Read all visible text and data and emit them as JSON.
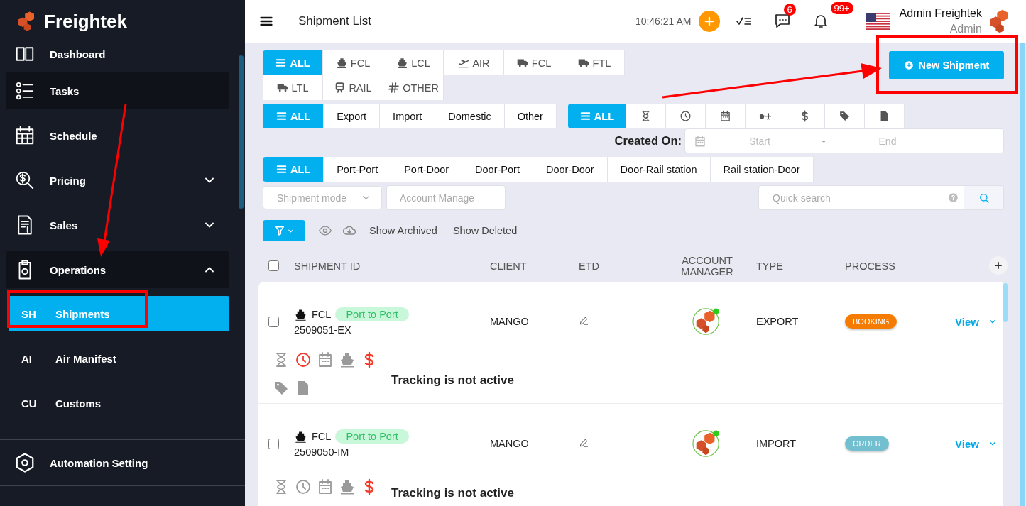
{
  "brand": {
    "name": "Freightek"
  },
  "sidebar": {
    "items": [
      {
        "kind": "link",
        "label": "Dashboard",
        "highlighted": false
      },
      {
        "kind": "link",
        "label": "Tasks",
        "highlighted": true
      },
      {
        "kind": "link",
        "label": "Schedule",
        "highlighted": false
      },
      {
        "kind": "group",
        "label": "Pricing",
        "highlighted": false,
        "expanded": false
      },
      {
        "kind": "group",
        "label": "Sales",
        "highlighted": false,
        "expanded": false
      },
      {
        "kind": "group",
        "label": "Operations",
        "highlighted": true,
        "expanded": true,
        "children": [
          {
            "abbr": "SH",
            "label": "Shipments",
            "selected": true
          },
          {
            "abbr": "AI",
            "label": "Air Manifest",
            "selected": false
          },
          {
            "abbr": "CU",
            "label": "Customs",
            "selected": false
          }
        ]
      }
    ],
    "footer_items": [
      {
        "label": "Automation Setting"
      }
    ]
  },
  "header": {
    "title": "Shipment List",
    "time": "10:46:21 AM",
    "messages_badge": "6",
    "notifications_badge": "99+",
    "user": {
      "name": "Admin Freightek",
      "role": "Admin"
    }
  },
  "new_shipment_button": "New Shipment",
  "mode_tabs": [
    {
      "label": "ALL",
      "selected": true
    },
    {
      "label": "FCL",
      "selected": false
    },
    {
      "label": "LCL",
      "selected": false
    },
    {
      "label": "AIR",
      "selected": false
    },
    {
      "label": "FCL",
      "selected": false
    },
    {
      "label": "FTL",
      "selected": false
    },
    {
      "label": "LTL",
      "selected": false
    },
    {
      "label": "RAIL",
      "selected": false
    },
    {
      "label": "OTHER",
      "selected": false
    }
  ],
  "direction_tabs": [
    {
      "label": "ALL",
      "selected": true
    },
    {
      "label": "Export",
      "selected": false
    },
    {
      "label": "Import",
      "selected": false
    },
    {
      "label": "Domestic",
      "selected": false
    },
    {
      "label": "Other",
      "selected": false
    }
  ],
  "status_tabs": [
    {
      "label": "ALL",
      "selected": true
    },
    {
      "selected": false
    },
    {
      "selected": false
    },
    {
      "selected": false
    },
    {
      "selected": false
    },
    {
      "selected": false
    },
    {
      "selected": false
    },
    {
      "selected": false
    }
  ],
  "created_on": {
    "label": "Created On:",
    "start_placeholder": "Start",
    "separator": "-",
    "end_placeholder": "End"
  },
  "route_tabs": [
    {
      "label": "ALL",
      "selected": true
    },
    {
      "label": "Port-Port",
      "selected": false
    },
    {
      "label": "Port-Door",
      "selected": false
    },
    {
      "label": "Door-Port",
      "selected": false
    },
    {
      "label": "Door-Door",
      "selected": false
    },
    {
      "label": "Door-Rail station",
      "selected": false
    },
    {
      "label": "Rail station-Door",
      "selected": false
    }
  ],
  "filters": {
    "shipment_mode": {
      "placeholder": "Shipment mode"
    },
    "account_manager": {
      "placeholder": "Account Manage"
    },
    "quick_search": {
      "placeholder": "Quick search"
    }
  },
  "toolbar": {
    "links": [
      "Show Archived",
      "Show Deleted"
    ]
  },
  "table": {
    "all_checked": false,
    "columns": [
      "SHIPMENT ID",
      "CLIENT",
      "ETD",
      "ACCOUNT MANAGER",
      "TYPE",
      "PROCESS"
    ],
    "rows": [
      {
        "checked": false,
        "mode": "FCL",
        "route": "Port to Port",
        "id": "2509051-EX",
        "client": "MANGO",
        "type": "EXPORT",
        "process": {
          "label": "BOOKING",
          "color": "#f57c00"
        },
        "action": "View",
        "milestones": [
          {
            "alert": false
          },
          {
            "alert": true
          },
          {
            "alert": false
          },
          {
            "alert": false
          },
          {
            "alert": true
          },
          {
            "alert": false
          },
          {
            "alert": false
          }
        ],
        "tracking": "Tracking is not active"
      },
      {
        "checked": false,
        "mode": "FCL",
        "route": "Port to Port",
        "id": "2509050-IM",
        "client": "MANGO",
        "type": "IMPORT",
        "process": {
          "label": "ORDER",
          "color": "#72c0cf"
        },
        "action": "View",
        "milestones": [
          {
            "alert": false
          },
          {
            "alert": false
          },
          {
            "alert": false
          },
          {
            "alert": false
          },
          {
            "alert": true
          }
        ],
        "tracking": "Tracking is not active"
      }
    ]
  }
}
